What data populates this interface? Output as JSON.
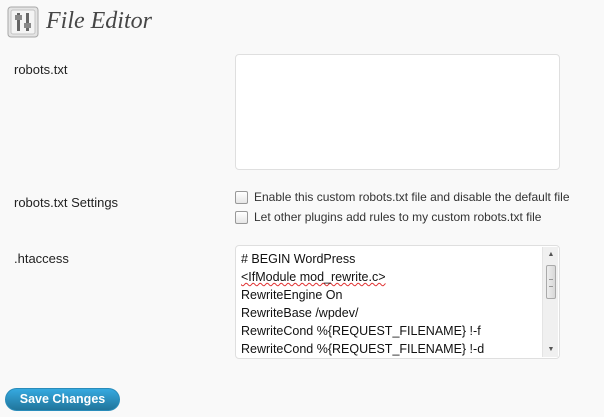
{
  "header": {
    "title": "File Editor",
    "icon": "tools-icon"
  },
  "robots": {
    "label": "robots.txt",
    "value": ""
  },
  "robots_settings": {
    "label": "robots.txt Settings",
    "options": [
      {
        "label": "Enable this custom robots.txt file and disable the default file",
        "checked": false
      },
      {
        "label": "Let other plugins add rules to my custom robots.txt file",
        "checked": false
      }
    ]
  },
  "htaccess": {
    "label": ".htaccess",
    "lines": [
      "# BEGIN WordPress",
      "<IfModule mod_rewrite.c>",
      "RewriteEngine On",
      "RewriteBase /wpdev/",
      "RewriteCond %{REQUEST_FILENAME} !-f",
      "RewriteCond %{REQUEST_FILENAME} !-d"
    ]
  },
  "actions": {
    "save_label": "Save Changes"
  },
  "colors": {
    "button": "#21759b",
    "background": "#f9f9f9"
  }
}
